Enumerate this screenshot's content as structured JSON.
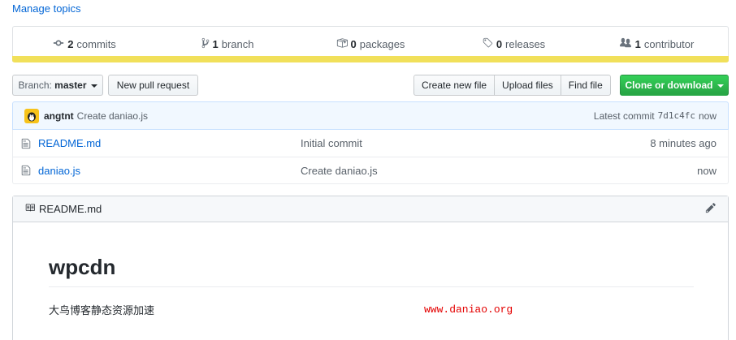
{
  "manage_topics": "Manage topics",
  "summary": {
    "commits": {
      "count": "2",
      "label": "commits"
    },
    "branch": {
      "count": "1",
      "label": "branch"
    },
    "packages": {
      "count": "0",
      "label": "packages"
    },
    "releases": {
      "count": "0",
      "label": "releases"
    },
    "contributors": {
      "count": "1",
      "label": "contributor"
    }
  },
  "language_bar_color": "#f1e05a",
  "file_nav": {
    "branch_prefix": "Branch:",
    "branch_name": "master",
    "new_pull_request": "New pull request",
    "create_new_file": "Create new file",
    "upload_files": "Upload files",
    "find_file": "Find file",
    "clone_or_download": "Clone or download"
  },
  "latest_commit": {
    "author": "angtnt",
    "message": "Create daniao.js",
    "label": "Latest commit",
    "sha": "7d1c4fc",
    "age": "now"
  },
  "files": [
    {
      "name": "README.md",
      "commit_message": "Initial commit",
      "age": "8 minutes ago"
    },
    {
      "name": "daniao.js",
      "commit_message": "Create daniao.js",
      "age": "now"
    }
  ],
  "readme": {
    "filename": "README.md",
    "heading": "wpcdn",
    "description": "大鸟博客静态资源加速"
  },
  "watermark": "www.daniao.org"
}
